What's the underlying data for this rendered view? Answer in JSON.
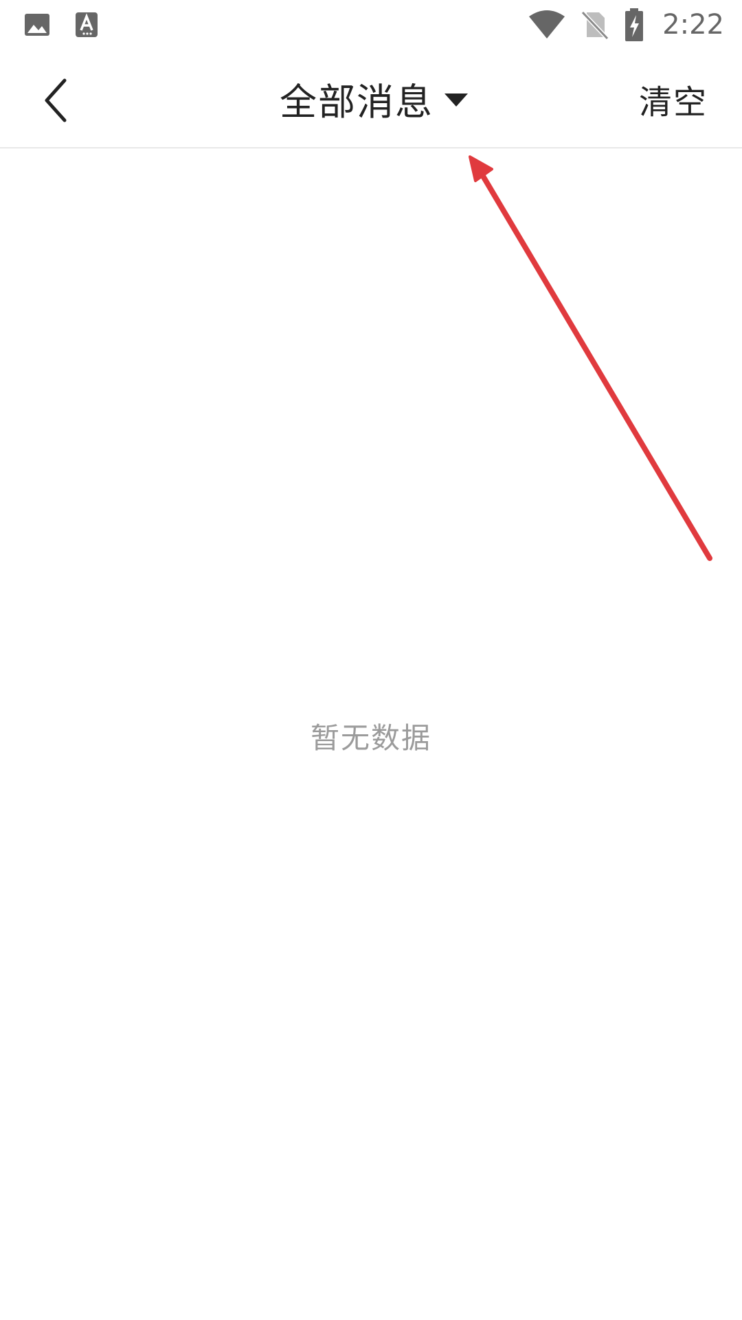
{
  "status_bar": {
    "time": "2:22",
    "left_icons": [
      "image-icon",
      "text-a-icon"
    ],
    "right_icons": [
      "wifi-icon",
      "no-sim-icon",
      "battery-charging-icon"
    ]
  },
  "toolbar": {
    "back_icon": "chevron-left-icon",
    "title": "全部消息",
    "dropdown_icon": "caret-down-icon",
    "clear_label": "清空"
  },
  "annotation": {
    "icon": "red-arrow-icon",
    "color": "#e03a3e"
  },
  "content": {
    "empty_text": "暂无数据"
  },
  "colors": {
    "title": "#222222",
    "empty_text": "#9b9b9b",
    "status_icons": "#666666",
    "divider": "#e8e8e8"
  }
}
